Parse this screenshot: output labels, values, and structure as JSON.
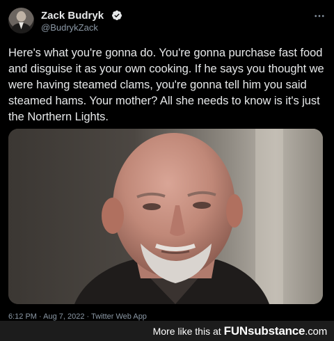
{
  "author": {
    "display_name": "Zack Budryk",
    "handle": "@BudrykZack"
  },
  "tweet": {
    "text": "Here's what you're gonna do. You're gonna purchase fast food and disguise it as your own cooking. If he says you thought we were having steamed clams, you're gonna tell him you said steamed hams. Your mother? All she needs to know is it's just the Northern Lights.",
    "meta": "6:12 PM · Aug 7, 2022 · Twitter Web App"
  },
  "footer": {
    "label": "More like this at",
    "brand_fun": "FUN",
    "brand_substance": "substance",
    "brand_suffix": ".com"
  },
  "icons": {
    "verified": "verified-badge-icon",
    "more": "more-options-icon"
  },
  "colors": {
    "background": "#000000",
    "text": "#e7e9ea",
    "secondary_text": "#8b98a5",
    "verified": "#1d9bf0",
    "footer_bg": "#1c1c1c"
  }
}
